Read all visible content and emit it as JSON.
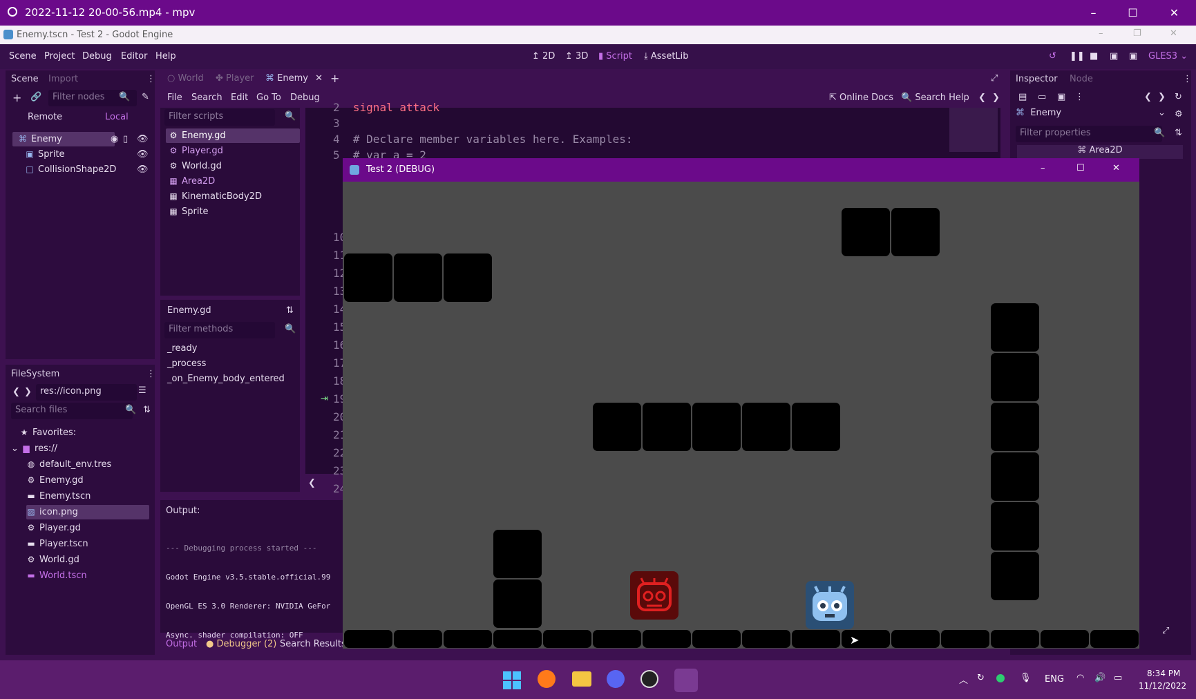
{
  "mpv": {
    "title": "2022-11-12 20-00-56.mp4 - mpv"
  },
  "godot": {
    "window_title": "Enemy.tscn - Test 2 - Godot Engine",
    "menu": [
      "Scene",
      "Project",
      "Debug",
      "Editor",
      "Help"
    ],
    "workspaces": [
      "2D",
      "3D",
      "Script",
      "AssetLib"
    ],
    "renderer": "GLES3",
    "scene_dock": {
      "tabs": [
        "Scene",
        "Import"
      ],
      "filter_placeholder": "Filter nodes",
      "remote": "Remote",
      "local": "Local",
      "nodes": [
        "Enemy",
        "Sprite",
        "CollisionShape2D"
      ]
    },
    "scene_tabs": [
      "World",
      "Player",
      "Enemy"
    ],
    "script_menu": [
      "File",
      "Search",
      "Edit",
      "Go To",
      "Debug"
    ],
    "online_docs": "Online Docs",
    "search_help": "Search Help",
    "script_filter_placeholder": "Filter scripts",
    "scripts": [
      "Enemy.gd",
      "Player.gd",
      "World.gd",
      "Area2D",
      "KinematicBody2D",
      "Sprite"
    ],
    "current_script": "Enemy.gd",
    "methods_filter_placeholder": "Filter methods",
    "methods": [
      "_ready",
      "_process",
      "_on_Enemy_body_entered"
    ],
    "code_lines": [
      {
        "n": "2",
        "text": "signal attack"
      },
      {
        "n": "3",
        "text": ""
      },
      {
        "n": "4",
        "text": "# Declare member variables here. Examples:"
      },
      {
        "n": "5",
        "text": "# var a = 2"
      }
    ],
    "gutter_numbers": [
      "10",
      "11",
      "12",
      "13",
      "14",
      "15",
      "16",
      "17",
      "18",
      "19",
      "20",
      "21",
      "22",
      "23",
      "24"
    ],
    "filesystem": {
      "title": "FileSystem",
      "path": "res://icon.png",
      "search_placeholder": "Search files",
      "favorites": "Favorites:",
      "root": "res://",
      "files": [
        "default_env.tres",
        "Enemy.gd",
        "Enemy.tscn",
        "icon.png",
        "Player.gd",
        "Player.tscn",
        "World.gd",
        "World.tscn"
      ]
    },
    "output": {
      "title": "Output:",
      "lines": [
        "--- Debugging process started ---",
        "Godot Engine v3.5.stable.official.99",
        "OpenGL ES 3.0 Renderer: NVIDIA GeFor",
        "Async. shader compilation: OFF"
      ]
    },
    "bottom_tabs": [
      "Output",
      "Debugger (2)",
      "Search Results"
    ],
    "inspector": {
      "tabs": [
        "Inspector",
        "Node"
      ],
      "object": "Enemy",
      "filter_placeholder": "Filter properties",
      "class": "Area2D"
    }
  },
  "game": {
    "title": "Test 2 (DEBUG)"
  },
  "taskbar": {
    "lang": "ENG",
    "time": "8:34 PM",
    "date": "11/12/2022"
  },
  "colors": {
    "accent": "#6b0a8a",
    "editor_bg": "#2a0b3a",
    "enemy_red": "#c01818",
    "player_blue": "#4a8ecb"
  }
}
